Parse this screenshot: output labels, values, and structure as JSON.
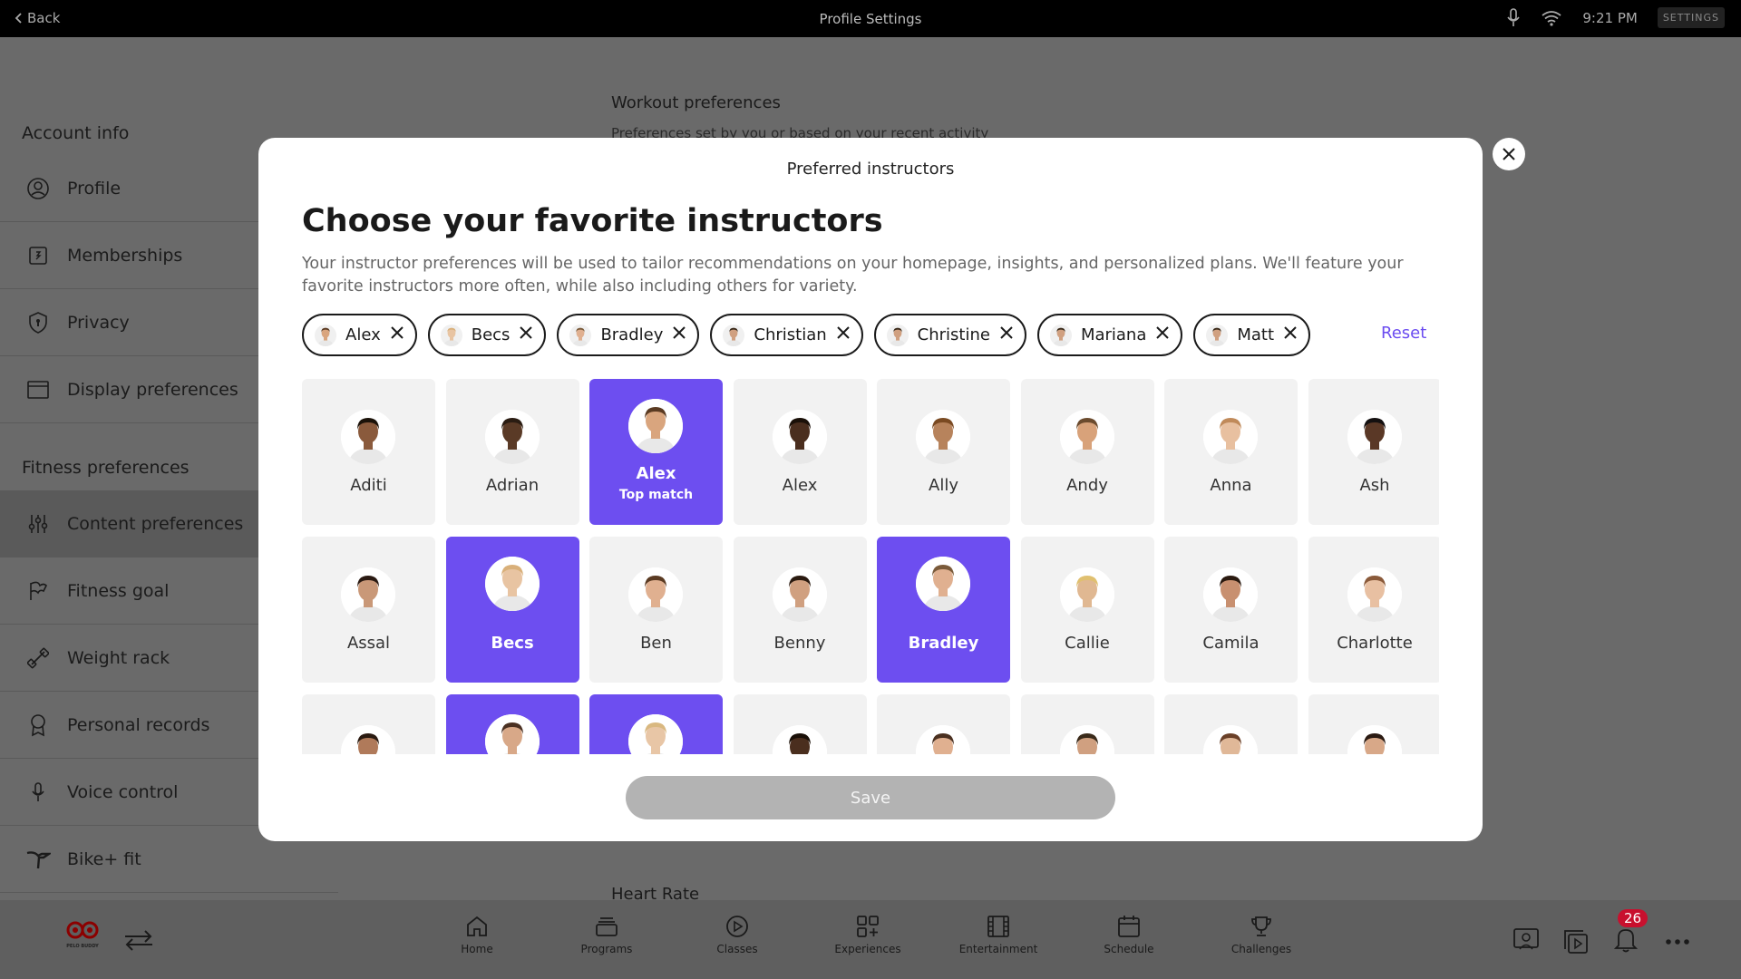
{
  "statusbar": {
    "back": "Back",
    "title": "Profile Settings",
    "time": "9:21 PM",
    "settings": "SETTINGS"
  },
  "sidebar": {
    "account_title": "Account info",
    "fitness_title": "Fitness preferences",
    "account_items": [
      {
        "label": "Profile",
        "icon": "user-circle-icon"
      },
      {
        "label": "Memberships",
        "icon": "membership-card-icon"
      },
      {
        "label": "Privacy",
        "icon": "shield-icon"
      },
      {
        "label": "Display preferences",
        "icon": "display-icon"
      }
    ],
    "fitness_items": [
      {
        "label": "Content preferences",
        "icon": "sliders-icon",
        "active": true
      },
      {
        "label": "Fitness goal",
        "icon": "flag-icon"
      },
      {
        "label": "Weight rack",
        "icon": "dumbbell-icon"
      },
      {
        "label": "Personal records",
        "icon": "award-icon"
      },
      {
        "label": "Voice control",
        "icon": "microphone-icon"
      },
      {
        "label": "Bike+ fit",
        "icon": "bike-icon"
      }
    ]
  },
  "background": {
    "workout_title": "Workout preferences",
    "workout_sub": "Preferences set by you or based on your recent activity",
    "heart_rate": "Heart Rate"
  },
  "modal": {
    "header": "Preferred instructors",
    "title": "Choose your favorite instructors",
    "description": "Your instructor preferences will be used to tailor recommendations on your homepage, insights, and personalized plans. We'll feature your favorite instructors more often, while also including others for variety.",
    "reset": "Reset",
    "save": "Save",
    "chips": [
      "Alex",
      "Becs",
      "Bradley",
      "Christian",
      "Christine",
      "Mariana",
      "Matt"
    ],
    "top_match": "Top match",
    "instructors": [
      {
        "name": "Aditi",
        "selected": false,
        "skin": "#8a5a3c",
        "hair": "#1b1209"
      },
      {
        "name": "Adrian",
        "selected": false,
        "skin": "#5a3a26",
        "hair": "#2a1c12"
      },
      {
        "name": "Alex",
        "selected": true,
        "top": true,
        "skin": "#d9a57e",
        "hair": "#5a3a22"
      },
      {
        "name": "Alex",
        "selected": false,
        "skin": "#4a2e1e",
        "hair": "#1a1008"
      },
      {
        "name": "Ally",
        "selected": false,
        "skin": "#b7835c",
        "hair": "#7a4a22"
      },
      {
        "name": "Andy",
        "selected": false,
        "skin": "#d8a27a",
        "hair": "#6b4b2e"
      },
      {
        "name": "Anna",
        "selected": false,
        "skin": "#e8c0a0",
        "hair": "#c08a5a"
      },
      {
        "name": "Ash",
        "selected": false,
        "skin": "#5a3826",
        "hair": "#141010"
      },
      {
        "name": "Assal",
        "selected": false,
        "skin": "#c99878",
        "hair": "#2a1a12"
      },
      {
        "name": "Becs",
        "selected": true,
        "skin": "#e8c4a2",
        "hair": "#d9b07a"
      },
      {
        "name": "Ben",
        "selected": false,
        "skin": "#e0b090",
        "hair": "#5a3a22"
      },
      {
        "name": "Benny",
        "selected": false,
        "skin": "#d0a080",
        "hair": "#2a1a10"
      },
      {
        "name": "Bradley",
        "selected": true,
        "skin": "#e0b090",
        "hair": "#7a5a3a"
      },
      {
        "name": "Callie",
        "selected": false,
        "skin": "#e0b892",
        "hair": "#e0c070"
      },
      {
        "name": "Camila",
        "selected": false,
        "skin": "#c89070",
        "hair": "#2a1a10"
      },
      {
        "name": "Charlotte",
        "selected": false,
        "skin": "#e8c0a2",
        "hair": "#8a5a3a"
      },
      {
        "name": "",
        "selected": false,
        "skin": "#b07a5a",
        "hair": "#2a1a10"
      },
      {
        "name": "",
        "selected": true,
        "skin": "#d8a888",
        "hair": "#4a3022"
      },
      {
        "name": "",
        "selected": true,
        "skin": "#e8c6a6",
        "hair": "#d9b880"
      },
      {
        "name": "",
        "selected": false,
        "skin": "#4a2e1e",
        "hair": "#1a1008"
      },
      {
        "name": "",
        "selected": false,
        "skin": "#e0b090",
        "hair": "#4a3020"
      },
      {
        "name": "",
        "selected": false,
        "skin": "#d0a080",
        "hair": "#3a2a1a"
      },
      {
        "name": "",
        "selected": false,
        "skin": "#e0b898",
        "hair": "#6a4028"
      },
      {
        "name": "",
        "selected": false,
        "skin": "#d8a888",
        "hair": "#2a1a12"
      }
    ]
  },
  "bottomnav": {
    "brand": "PELO BUDDY",
    "items": [
      {
        "label": "Home",
        "icon": "home-icon"
      },
      {
        "label": "Programs",
        "icon": "programs-icon"
      },
      {
        "label": "Classes",
        "icon": "play-icon"
      },
      {
        "label": "Experiences",
        "icon": "grid-plus-icon"
      },
      {
        "label": "Entertainment",
        "icon": "film-icon"
      },
      {
        "label": "Schedule",
        "icon": "calendar-icon"
      },
      {
        "label": "Challenges",
        "icon": "trophy-icon"
      }
    ],
    "notifications": "26"
  },
  "colors": {
    "accent": "#6d4ef0",
    "chip_border": "#1a1a1a",
    "save_disabled": "#b3b3b3",
    "badge": "#c8102e"
  }
}
